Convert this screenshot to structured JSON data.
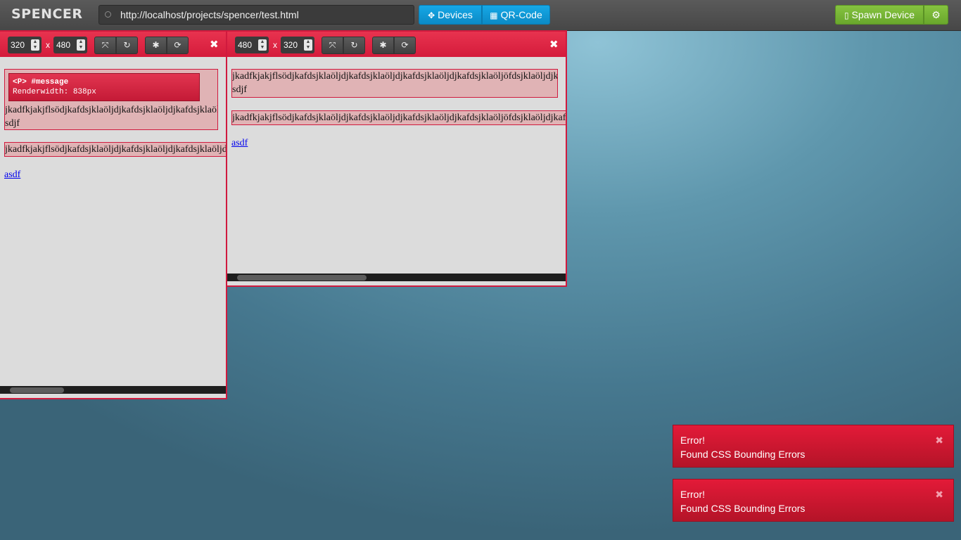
{
  "app": {
    "title": "SPENCER"
  },
  "urlbar": {
    "url": "http://localhost/projects/spencer/test.html",
    "icon": "compass-icon"
  },
  "header_buttons": {
    "devices": "Devices",
    "qrcode": "QR-Code",
    "spawn": "Spawn Device"
  },
  "devices": [
    {
      "width": "320",
      "height": "480",
      "separator": "x",
      "tooltip": {
        "selector": "<P> #message",
        "render": "Renderwidth: 838px"
      },
      "paragraph1": "jkadfkjakjflsödjkafdsjklaöljdjkafdsjklaöljdjkafdsjklaöljdjkafdsjklaöljöfdsjklaöljdjkafdsjklaöljdjkafdsjklaöljdjkafdsjklaöljdjkafdsjk",
      "paragraph1_line2": "sdjf",
      "paragraph2": "jkadfkjakjflsödjkafdsjklaöljdjkafdsjklaöljdjkafdsjklaöljdjkafdsjklaöljöfdsjklaöljdjkafdsjklaöljdjkafdsjklaöljdjkafdsjk",
      "link": "asdf"
    },
    {
      "width": "480",
      "height": "320",
      "separator": "x",
      "paragraph1": "jkadfkjakjflsödjkafdsjklaöljdjkafdsjklaöljdjkafdsjklaöljdjkafdsjklaöljöfdsjklaöljdjkafdsjklaöljdjkafdsjk",
      "paragraph1_line2": "sdjf",
      "paragraph2": "jkadfkjakjflsödjkafdsjklaöljdjkafdsjklaöljdjkafdsjklaöljdjkafdsjklaöljöfdsjklaöljdjkafdsjklaöljdjkafdsjk",
      "link": "asdf"
    }
  ],
  "toasts": [
    {
      "title": "Error!",
      "message": "Found CSS Bounding Errors"
    },
    {
      "title": "Error!",
      "message": "Found CSS Bounding Errors"
    }
  ],
  "colors": {
    "accent": "#d01a3e",
    "blue": "#0b8ac6",
    "green": "#69a72c"
  }
}
